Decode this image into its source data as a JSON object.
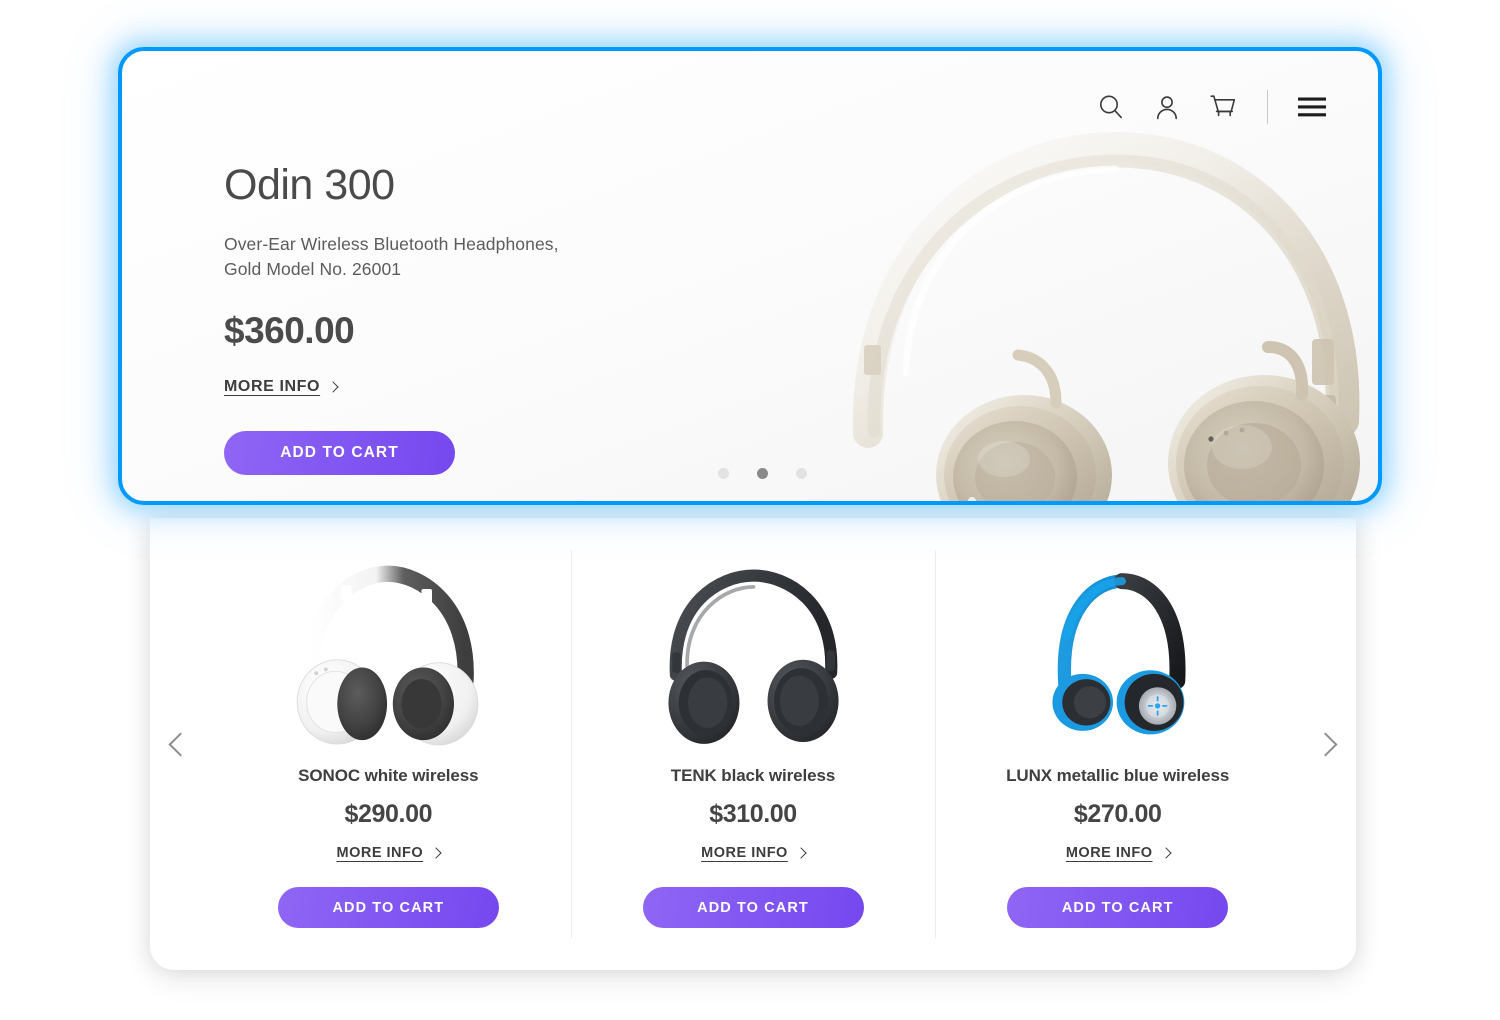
{
  "header": {
    "icons": [
      {
        "name": "search-icon",
        "label": "Search"
      },
      {
        "name": "account-icon",
        "label": "Account"
      },
      {
        "name": "cart-icon",
        "label": "Cart"
      },
      {
        "name": "menu-icon",
        "label": "Menu"
      }
    ]
  },
  "hero": {
    "title": "Odin 300",
    "subtitle": "Over-Ear Wireless Bluetooth Headphones,\nGold Model No. 26001",
    "subtitle_line1": "Over-Ear Wireless Bluetooth Headphones,",
    "subtitle_line2": "Gold Model No. 26001",
    "price": "$360.00",
    "more_info_label": "MORE INFO",
    "add_to_cart_label": "ADD TO CART",
    "image_alt": "gold-over-ear-headphones",
    "dots": [
      {
        "active": false
      },
      {
        "active": true
      },
      {
        "active": false
      }
    ]
  },
  "carousel": {
    "prev_label": "Previous",
    "next_label": "Next"
  },
  "products": [
    {
      "name": "SONOC white wireless",
      "price": "$290.00",
      "more_info_label": "MORE INFO",
      "add_to_cart_label": "ADD TO CART",
      "image_alt": "white-over-ear-headphones"
    },
    {
      "name": "TENK black wireless",
      "price": "$310.00",
      "more_info_label": "MORE INFO",
      "add_to_cart_label": "ADD TO CART",
      "image_alt": "black-over-ear-headphones"
    },
    {
      "name": "LUNX metallic blue wireless",
      "price": "$270.00",
      "more_info_label": "MORE INFO",
      "add_to_cart_label": "ADD TO CART",
      "image_alt": "blue-on-ear-headphones"
    }
  ],
  "colors": {
    "highlight_border": "#0099FF",
    "cart_button_gradient_start": "#8F66F5",
    "cart_button_gradient_end": "#7548EF",
    "text_primary": "#4A4A4A",
    "dot_active": "#8A8A8A",
    "dot_inactive": "#E2E2E2"
  }
}
